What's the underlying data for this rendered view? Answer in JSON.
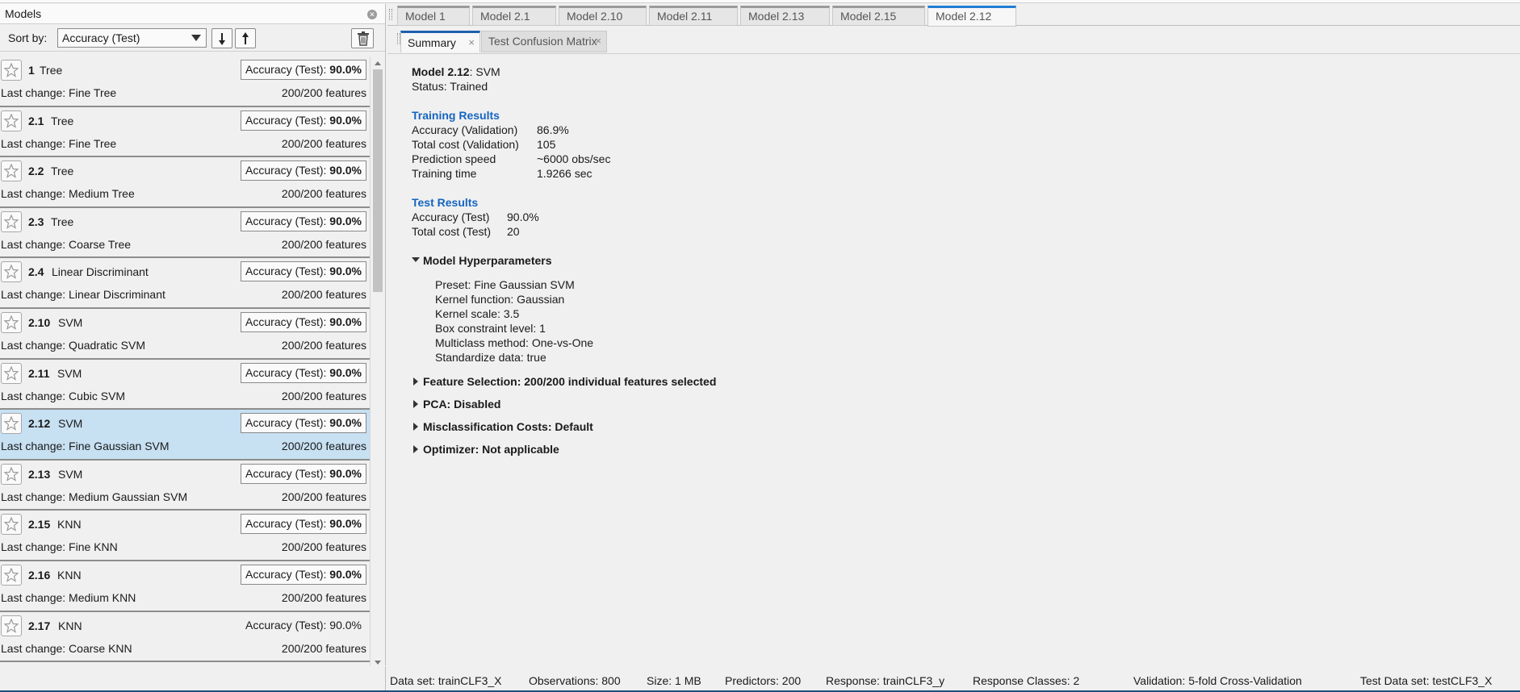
{
  "models_panel": {
    "title": "Models",
    "sort_label": "Sort by:",
    "sort_value": "Accuracy (Test)"
  },
  "models": [
    {
      "num": "1",
      "type": "Tree",
      "acc_label": "Accuracy (Test): ",
      "acc_value": "90.0%",
      "change": "Last change: Fine Tree",
      "features": "200/200 features"
    },
    {
      "num": "2.1",
      "type": "Tree",
      "acc_label": "Accuracy (Test): ",
      "acc_value": "90.0%",
      "change": "Last change: Fine Tree",
      "features": "200/200 features"
    },
    {
      "num": "2.2",
      "type": "Tree",
      "acc_label": "Accuracy (Test): ",
      "acc_value": "90.0%",
      "change": "Last change: Medium Tree",
      "features": "200/200 features"
    },
    {
      "num": "2.3",
      "type": "Tree",
      "acc_label": "Accuracy (Test): ",
      "acc_value": "90.0%",
      "change": "Last change: Coarse Tree",
      "features": "200/200 features"
    },
    {
      "num": "2.4",
      "type": "Linear Discriminant",
      "acc_label": "Accuracy (Test): ",
      "acc_value": "90.0%",
      "change": "Last change: Linear Discriminant",
      "features": "200/200 features"
    },
    {
      "num": "2.10",
      "type": "SVM",
      "acc_label": "Accuracy (Test): ",
      "acc_value": "90.0%",
      "change": "Last change: Quadratic SVM",
      "features": "200/200 features"
    },
    {
      "num": "2.11",
      "type": "SVM",
      "acc_label": "Accuracy (Test): ",
      "acc_value": "90.0%",
      "change": "Last change: Cubic SVM",
      "features": "200/200 features"
    },
    {
      "num": "2.12",
      "type": "SVM",
      "acc_label": "Accuracy (Test): ",
      "acc_value": "90.0%",
      "change": "Last change: Fine Gaussian SVM",
      "features": "200/200 features"
    },
    {
      "num": "2.13",
      "type": "SVM",
      "acc_label": "Accuracy (Test): ",
      "acc_value": "90.0%",
      "change": "Last change: Medium Gaussian SVM",
      "features": "200/200 features"
    },
    {
      "num": "2.15",
      "type": "KNN",
      "acc_label": "Accuracy (Test): ",
      "acc_value": "90.0%",
      "change": "Last change: Fine KNN",
      "features": "200/200 features"
    },
    {
      "num": "2.16",
      "type": "KNN",
      "acc_label": "Accuracy (Test): ",
      "acc_value": "90.0%",
      "change": "Last change: Medium KNN",
      "features": "200/200 features"
    },
    {
      "num": "2.17",
      "type": "KNN",
      "acc_label": "Accuracy (Test): ",
      "acc_value": "90.0%",
      "change": "Last change: Coarse KNN",
      "features": "200/200 features"
    }
  ],
  "model_tabs": [
    "Model 1",
    "Model 2.1",
    "Model 2.10",
    "Model 2.11",
    "Model 2.13",
    "Model 2.15",
    "Model 2.12"
  ],
  "sub_tabs": [
    "Summary",
    "Test Confusion Matrix"
  ],
  "summary": {
    "model_name": "Model 2.12",
    "model_type": ": SVM",
    "status": "Status: Trained",
    "training_title": "Training Results",
    "training": [
      {
        "k": "Accuracy (Validation)",
        "v": "86.9%"
      },
      {
        "k": "Total cost (Validation)",
        "v": "105"
      },
      {
        "k": "Prediction speed",
        "v": "~6000 obs/sec"
      },
      {
        "k": "Training time",
        "v": "1.9266 sec"
      }
    ],
    "test_title": "Test Results",
    "test": [
      {
        "k": "Accuracy (Test)",
        "v": "90.0%"
      },
      {
        "k": "Total cost (Test)",
        "v": "20"
      }
    ],
    "hyper_title": "Model Hyperparameters",
    "hyper": [
      "Preset: Fine Gaussian SVM",
      "Kernel function: Gaussian",
      "Kernel scale: 3.5",
      "Box constraint level: 1",
      "Multiclass method: One-vs-One",
      "Standardize data: true"
    ],
    "feature_sel": "Feature Selection: 200/200 individual features selected",
    "pca": "PCA: Disabled",
    "misclass": "Misclassification Costs: Default",
    "optimizer": "Optimizer: Not applicable"
  },
  "status_bar": {
    "dataset": "Data set: trainCLF3_X",
    "observations": "Observations: 800",
    "size": "Size: 1 MB",
    "predictors": "Predictors: 200",
    "response": "Response: trainCLF3_y",
    "classes": "Response Classes: 2",
    "validation": "Validation: 5-fold Cross-Validation",
    "testset": "Test Data set: testCLF3_X"
  }
}
